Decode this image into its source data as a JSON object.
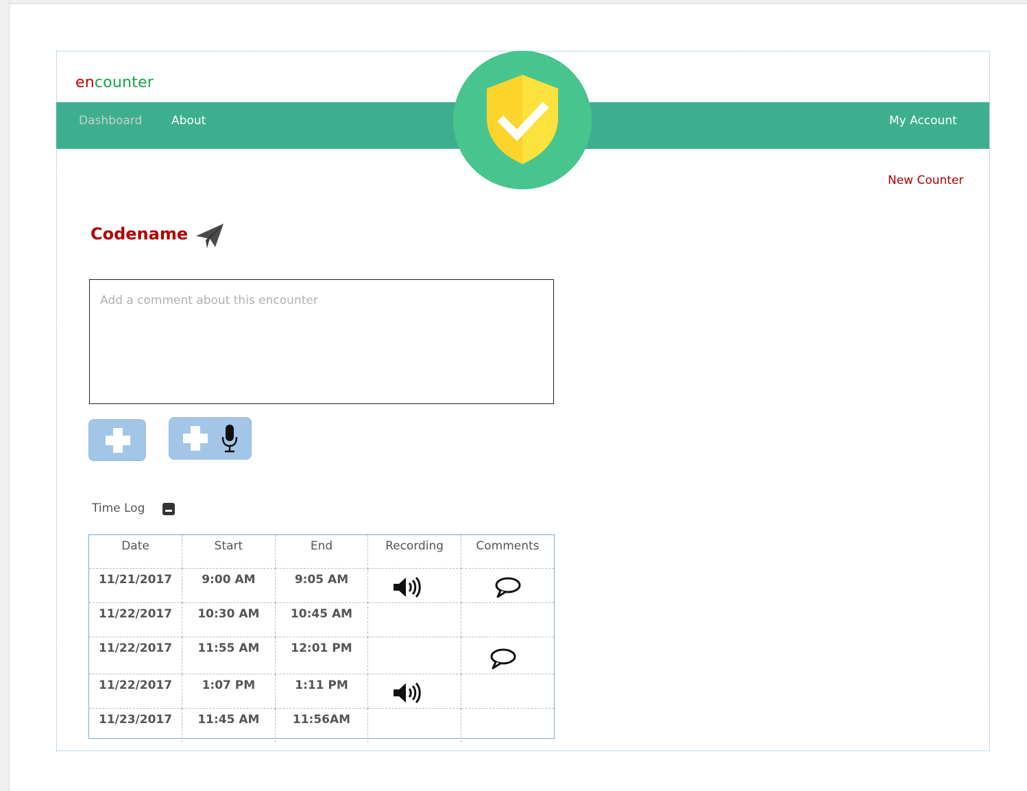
{
  "brand": {
    "prefix": "en",
    "suffix": "counter",
    "prefix_color": "#c00000",
    "suffix_color": "#17a34a"
  },
  "nav": {
    "dashboard": "Dashboard",
    "about": "About",
    "account": "My Account",
    "bar_color": "#3daf8f"
  },
  "badge": {
    "icon": "shield-check-icon",
    "circle_color": "#48c58f",
    "shield_color": "#fcd42c"
  },
  "actions": {
    "new_counter": "New Counter"
  },
  "counter": {
    "title": "Codename",
    "send_icon": "paper-plane-icon"
  },
  "comment": {
    "placeholder": "Add a comment about this encounter",
    "value": ""
  },
  "buttons": {
    "add_icon": "plus-icon",
    "add_voice_icons": [
      "plus-icon",
      "microphone-icon"
    ]
  },
  "timelog": {
    "label": "Time Log",
    "toggle_icon": "minus-square-icon",
    "columns": [
      "Date",
      "Start",
      "End",
      "Recording",
      "Comments"
    ],
    "rows": [
      {
        "date": "11/21/2017",
        "start": "9:00 AM",
        "end": "9:05 AM",
        "recording": "speaker-icon",
        "comment": "speech-bubble-icon"
      },
      {
        "date": "11/22/2017",
        "start": "10:30 AM",
        "end": "10:45 AM",
        "recording": "",
        "comment": ""
      },
      {
        "date": "11/22/2017",
        "start": "11:55 AM",
        "end": "12:01 PM",
        "recording": "",
        "comment": "speech-bubble-icon"
      },
      {
        "date": "11/22/2017",
        "start": "1:07 PM",
        "end": "1:11 PM",
        "recording": "speaker-icon",
        "comment": ""
      },
      {
        "date": "11/23/2017",
        "start": "11:45 AM",
        "end": "11:56AM",
        "recording": "",
        "comment": ""
      }
    ]
  }
}
